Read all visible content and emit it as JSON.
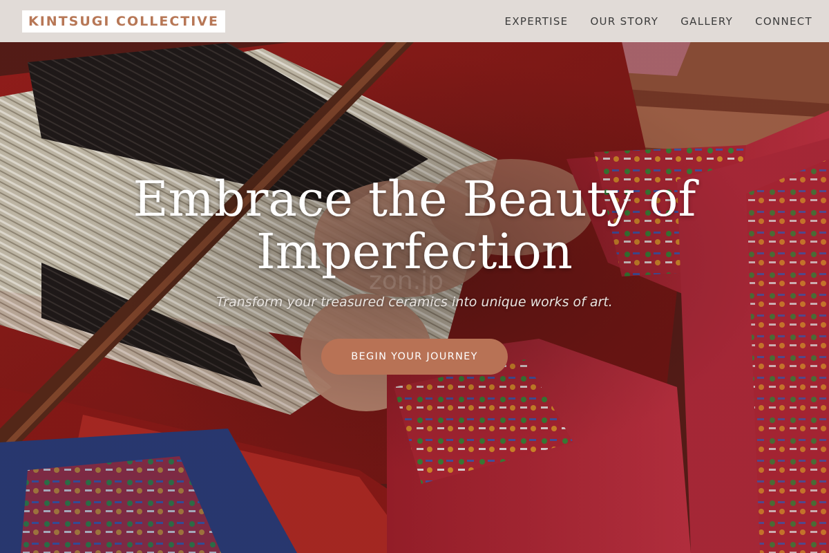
{
  "brand": {
    "name": "KINTSUGI COLLECTIVE",
    "accent_color": "#b87255"
  },
  "nav": {
    "items": [
      {
        "label": "EXPERTISE"
      },
      {
        "label": "OUR STORY"
      },
      {
        "label": "GALLERY"
      },
      {
        "label": "CONNECT"
      }
    ]
  },
  "hero": {
    "title": "Embrace the Beauty of Imperfection",
    "subtitle": "Transform your treasured ceramics into unique works of art.",
    "cta_label": "BEGIN YOUR JOURNEY",
    "watermark": "zon.jp",
    "background_image": "hands weaving colorful textile on a loom"
  }
}
